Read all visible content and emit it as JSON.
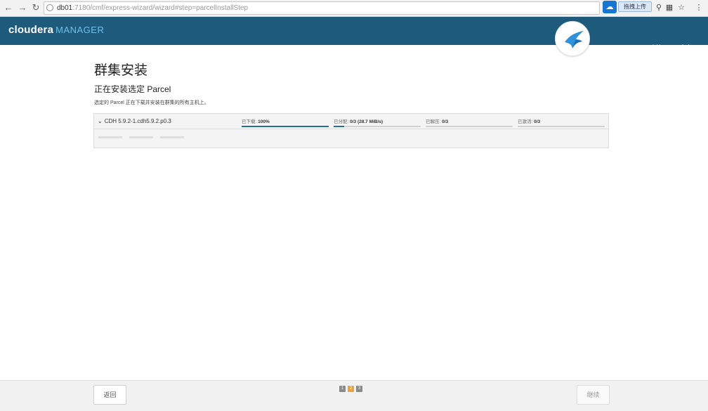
{
  "browser": {
    "url_host": "db01",
    "url_rest": ":7180/cmf/express-wizard/wizard#step=parcelInstallStep",
    "extension_label": "拖拽上传"
  },
  "header": {
    "brand": "cloudera",
    "brand_suffix": "MANAGER",
    "support_menu": "支持 ▾",
    "user_menu": "admin ▾"
  },
  "page": {
    "title": "群集安装",
    "section_title": "正在安装选定 Parcel",
    "description": "选定的 Parcel 正在下载并安装在群集的所有主机上。"
  },
  "parcel": {
    "name": "CDH 5.9.2-1.cdh5.9.2.p0.3",
    "stages": [
      {
        "label": "已下载:",
        "value": "100%",
        "progress": 1.0
      },
      {
        "label": "已分配:",
        "value": "0/3 (28.7 MiB/s)",
        "progress": 0.12
      },
      {
        "label": "已解压:",
        "value": "0/3",
        "progress": 0
      },
      {
        "label": "已激活:",
        "value": "0/3",
        "progress": 0
      }
    ]
  },
  "footer": {
    "back_label": "返回",
    "continue_label": "继续",
    "steps": [
      "1",
      "2",
      "3"
    ],
    "active_step": 2
  }
}
